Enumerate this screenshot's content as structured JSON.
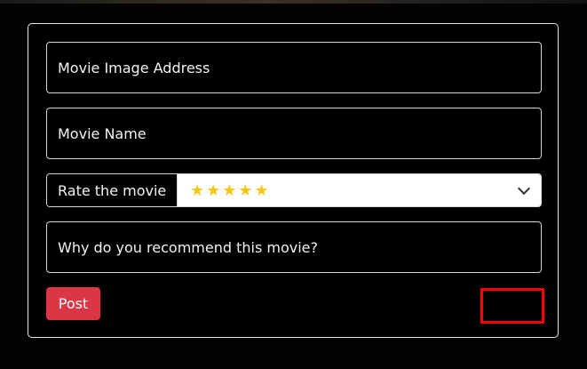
{
  "form": {
    "image_placeholder": "Movie Image Address",
    "name_placeholder": "Movie Name",
    "rating_label": "Rate the movie",
    "rating_value": "★★★★★",
    "recommend_placeholder": "Why do you recommend this movie?",
    "post_label": "Post"
  },
  "colors": {
    "accent": "#dc3545",
    "star": "#f5c518",
    "highlight": "#ff0000"
  }
}
